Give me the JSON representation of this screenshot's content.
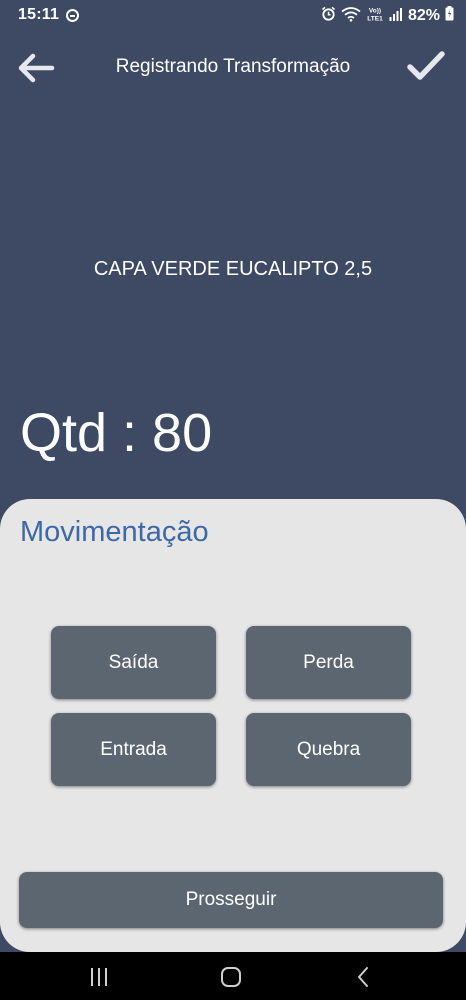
{
  "status_bar": {
    "time": "15:11",
    "battery": "82%",
    "network": "VoLTE1"
  },
  "header": {
    "title": "Registrando Transformação",
    "back_icon": "arrow-left-icon",
    "confirm_icon": "checkmark-icon"
  },
  "product": {
    "name": "CAPA VERDE EUCALIPTO 2,5"
  },
  "quantity": {
    "text": "Qtd : 80"
  },
  "movement": {
    "title": "Movimentação",
    "buttons": [
      {
        "label": "Saída"
      },
      {
        "label": "Perda"
      },
      {
        "label": "Entrada"
      },
      {
        "label": "Quebra"
      }
    ],
    "proceed_label": "Prosseguir"
  },
  "colors": {
    "header_bg": "#3e4a63",
    "sheet_bg": "#e6e6e6",
    "button_bg": "#5b6670",
    "accent_title": "#3c68a8"
  },
  "nav_bar": {
    "recents_icon": "recents-icon",
    "home_icon": "home-icon",
    "back_icon": "nav-back-icon"
  }
}
